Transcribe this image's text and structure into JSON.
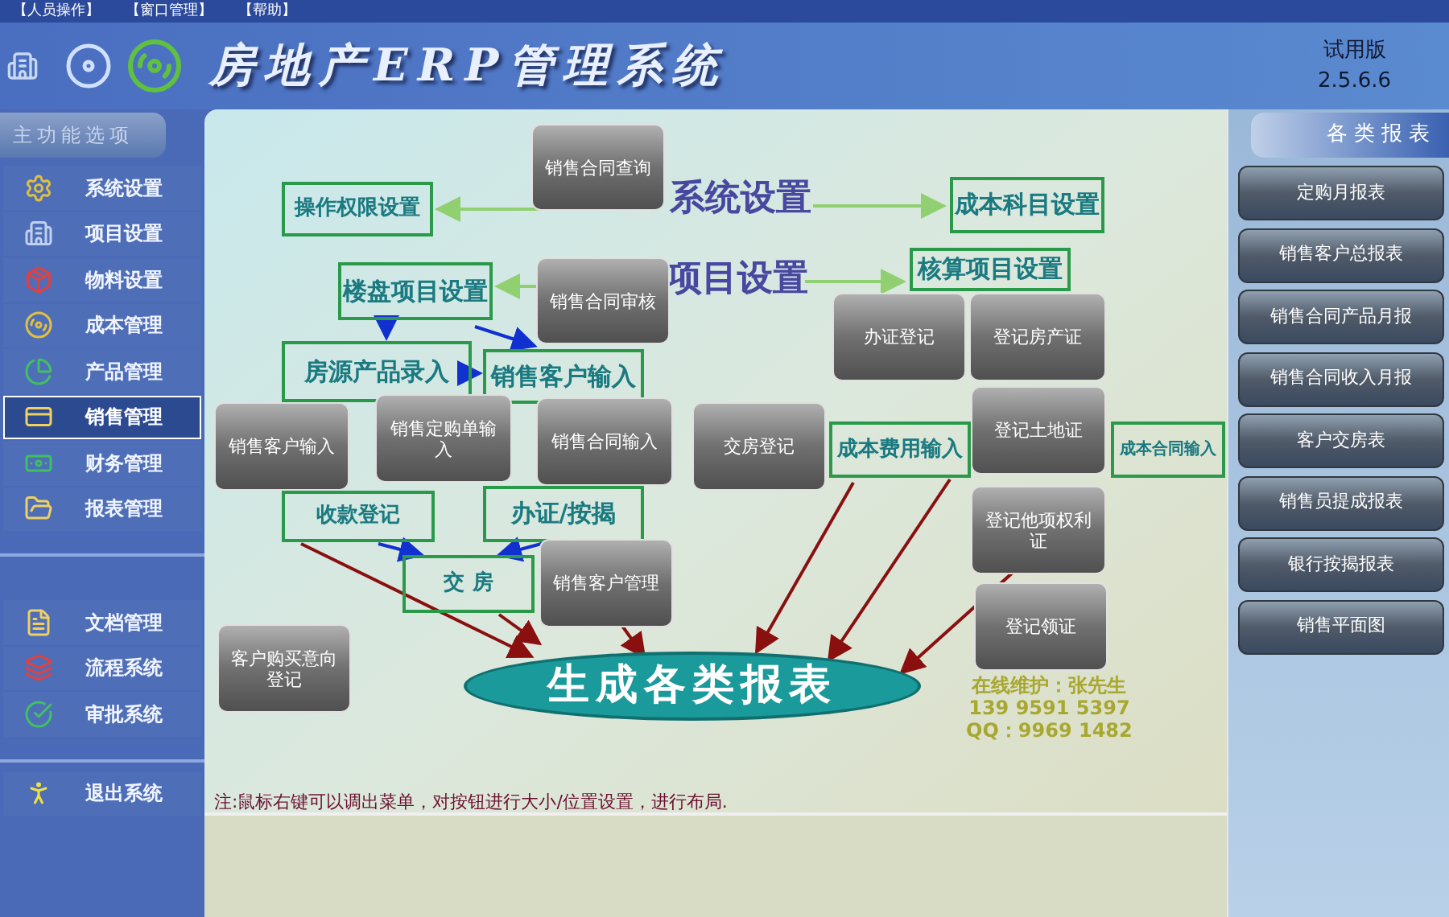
{
  "menu": [
    "【人员操作】",
    "【窗口管理】",
    "【帮助】"
  ],
  "header": {
    "title": "房地产ERP管理系统",
    "edition": "试用版",
    "version": "2.5.6.6"
  },
  "sidebar": {
    "title": "主功能选项",
    "groups": [
      [
        {
          "label": "系统设置",
          "selected": false
        },
        {
          "label": "项目设置",
          "selected": false
        },
        {
          "label": "物料设置",
          "selected": false
        },
        {
          "label": "成本管理",
          "selected": false
        },
        {
          "label": "产品管理",
          "selected": false
        },
        {
          "label": "销售管理",
          "selected": true
        },
        {
          "label": "财务管理",
          "selected": false
        },
        {
          "label": "报表管理",
          "selected": false
        }
      ],
      [
        {
          "label": "文档管理",
          "selected": false
        },
        {
          "label": "流程系统",
          "selected": false
        },
        {
          "label": "审批系统",
          "selected": false
        }
      ],
      [
        {
          "label": "退出系统",
          "selected": false
        }
      ]
    ]
  },
  "flowchart": {
    "nodes": [
      {
        "kind": "heading",
        "label": "系统设置"
      },
      {
        "kind": "heading",
        "label": "项目设置"
      },
      {
        "kind": "box",
        "label": "操作权限设置"
      },
      {
        "kind": "box",
        "label": "成本科目设置"
      },
      {
        "kind": "box",
        "label": "楼盘项目设置"
      },
      {
        "kind": "box",
        "label": "核算项目设置"
      },
      {
        "kind": "box",
        "label": "房源产品录入"
      },
      {
        "kind": "box",
        "label": "销售客户输入"
      },
      {
        "kind": "box",
        "label": "成本费用输入"
      },
      {
        "kind": "box",
        "label": "成本合同输入"
      },
      {
        "kind": "box",
        "label": "收款登记"
      },
      {
        "kind": "box",
        "label": "办证/按揭"
      },
      {
        "kind": "box",
        "label": "交 房"
      },
      {
        "kind": "ellipse",
        "label": "生成各类报表"
      }
    ],
    "contact": [
      "在线维护：张先生",
      "139 9591 5397",
      "QQ：9969 1482"
    ]
  },
  "buttons": [
    "销售合同查询",
    "销售合同审核",
    "办证登记",
    "登记房产证",
    "销售客户输入",
    "销售定购单输入",
    "销售合同输入",
    "交房登记",
    "登记土地证",
    "登记他项权利证",
    "销售客户管理",
    "登记领证",
    "客户购买意向登记"
  ],
  "note": "注:鼠标右键可以调出菜单，对按钮进行大小/位置设置，进行布局.",
  "reports": {
    "title": "各类报表",
    "items": [
      "定购月报表",
      "销售客户总报表",
      "销售合同产品月报",
      "销售合同收入月报",
      "客户交房表",
      "销售员提成报表",
      "银行按揭报表",
      "销售平面图"
    ]
  }
}
